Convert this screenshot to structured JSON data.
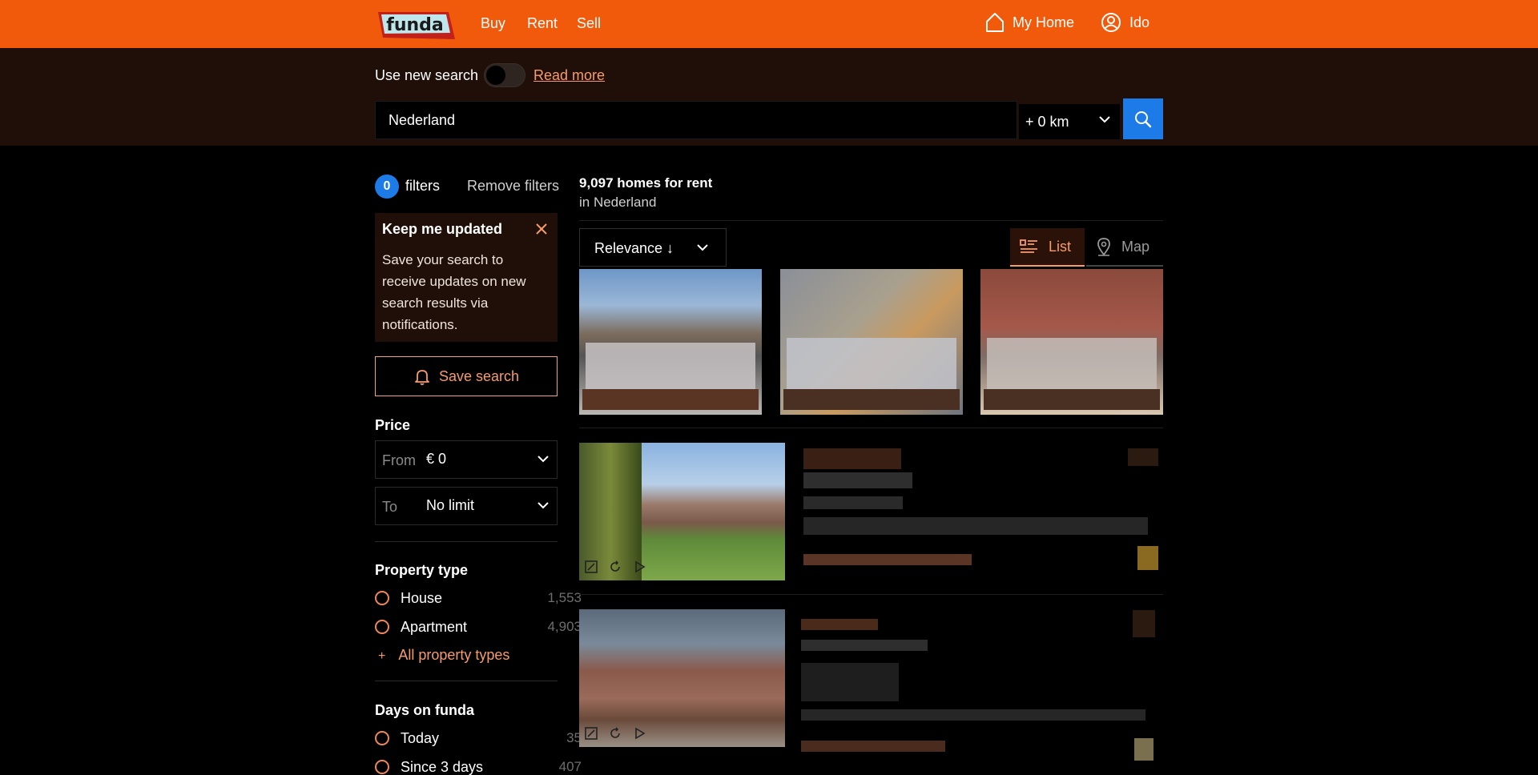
{
  "nav": {
    "logo_text": "funda",
    "links": [
      "Buy",
      "Rent",
      "Sell"
    ],
    "my_home": "My Home",
    "user": "Ido"
  },
  "searchbar": {
    "toggle_label": "Use new search",
    "read_more": "Read more",
    "location": "Nederland",
    "radius": "+ 0 km"
  },
  "sidebar": {
    "filter_count": "0",
    "filters_label": "filters",
    "remove_filters": "Remove filters",
    "keep_updated": {
      "title": "Keep me updated",
      "text": "Save your search to receive updates on new search results via notifications."
    },
    "save_search": "Save search",
    "price": {
      "title": "Price",
      "from_label": "From",
      "from_value": "€ 0",
      "to_label": "To",
      "to_value": "No limit"
    },
    "property_type": {
      "title": "Property type",
      "options": [
        {
          "label": "House",
          "count": "1,553"
        },
        {
          "label": "Apartment",
          "count": "4,903"
        }
      ],
      "all_link": "All property types"
    },
    "days_on_funda": {
      "title": "Days on funda",
      "options": [
        {
          "label": "Today",
          "count": "35"
        },
        {
          "label": "Since 3 days",
          "count": "407"
        }
      ]
    }
  },
  "results": {
    "count_text": "9,097 homes for rent",
    "location_text": "in Nederland",
    "sort": "Relevance ↓",
    "views": [
      "List",
      "Map"
    ]
  },
  "colors": {
    "brand_orange": "#f25a0b",
    "accent_orange": "#f59b6e",
    "accent_blue": "#1d7be8",
    "header_band": "#1f0f08"
  }
}
